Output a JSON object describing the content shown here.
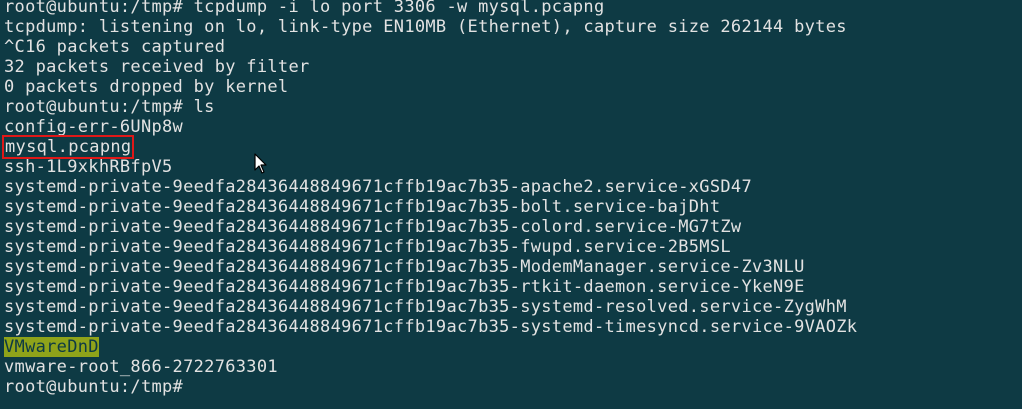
{
  "window": {
    "title": "root@ubuntu:/tmp"
  },
  "terminal": {
    "lines": [
      "root@ubuntu:/tmp# tcpdump -i lo port 3306 -w mysql.pcapng",
      "tcpdump: listening on lo, link-type EN10MB (Ethernet), capture size 262144 bytes",
      "^C16 packets captured",
      "32 packets received by filter",
      "0 packets dropped by kernel",
      "root@ubuntu:/tmp# ls",
      "config-err-6UNp8w",
      "mysql.pcapng",
      "ssh-1L9xkhRBfpV5",
      "systemd-private-9eedfa28436448849671cffb19ac7b35-apache2.service-xGSD47",
      "systemd-private-9eedfa28436448849671cffb19ac7b35-bolt.service-bajDht",
      "systemd-private-9eedfa28436448849671cffb19ac7b35-colord.service-MG7tZw",
      "systemd-private-9eedfa28436448849671cffb19ac7b35-fwupd.service-2B5MSL",
      "systemd-private-9eedfa28436448849671cffb19ac7b35-ModemManager.service-Zv3NLU",
      "systemd-private-9eedfa28436448849671cffb19ac7b35-rtkit-daemon.service-YkeN9E",
      "systemd-private-9eedfa28436448849671cffb19ac7b35-systemd-resolved.service-ZygWhM",
      "systemd-private-9eedfa28436448849671cffb19ac7b35-systemd-timesyncd.service-9VAOZk",
      "VMwareDnD",
      "vmware-root_866-2722763301",
      "root@ubuntu:/tmp#"
    ]
  },
  "colors": {
    "background": "#0e3a44",
    "foreground": "#e2e2e2",
    "highlight_box": "#e01818",
    "directory_highlight": "#8fa31a"
  },
  "icons": {
    "cursor": "mouse-pointer-icon"
  }
}
